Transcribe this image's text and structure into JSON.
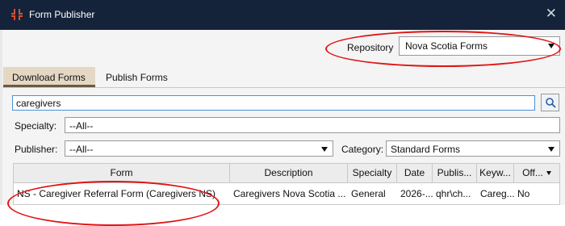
{
  "window": {
    "title": "Form Publisher"
  },
  "repository": {
    "label": "Repository",
    "value": "Nova Scotia Forms"
  },
  "tabs": [
    {
      "label": "Download Forms"
    },
    {
      "label": "Publish Forms"
    }
  ],
  "search": {
    "value": "caregivers"
  },
  "filters": {
    "specialty": {
      "label": "Specialty:",
      "value": "--All--"
    },
    "publisher": {
      "label": "Publisher:",
      "value": "--All--"
    },
    "category": {
      "label": "Category:",
      "value": "Standard Forms"
    }
  },
  "table": {
    "columns": [
      "Form",
      "Description",
      "Specialty",
      "Date",
      "Publis...",
      "Keyw...",
      "Off..."
    ],
    "rows": [
      [
        "NS - Caregiver Referral Form (Caregivers NS)",
        "Caregivers Nova Scotia ...",
        "General",
        "2026-...",
        "qhr\\ch...",
        "Careg...",
        "No"
      ]
    ]
  },
  "colors": {
    "titlebar": "#14233a",
    "annotation": "#e01414",
    "active_tab": "#e4d8c4"
  },
  "icons": {
    "app": "form-publisher-icon",
    "close": "close-icon",
    "search": "search-icon"
  }
}
